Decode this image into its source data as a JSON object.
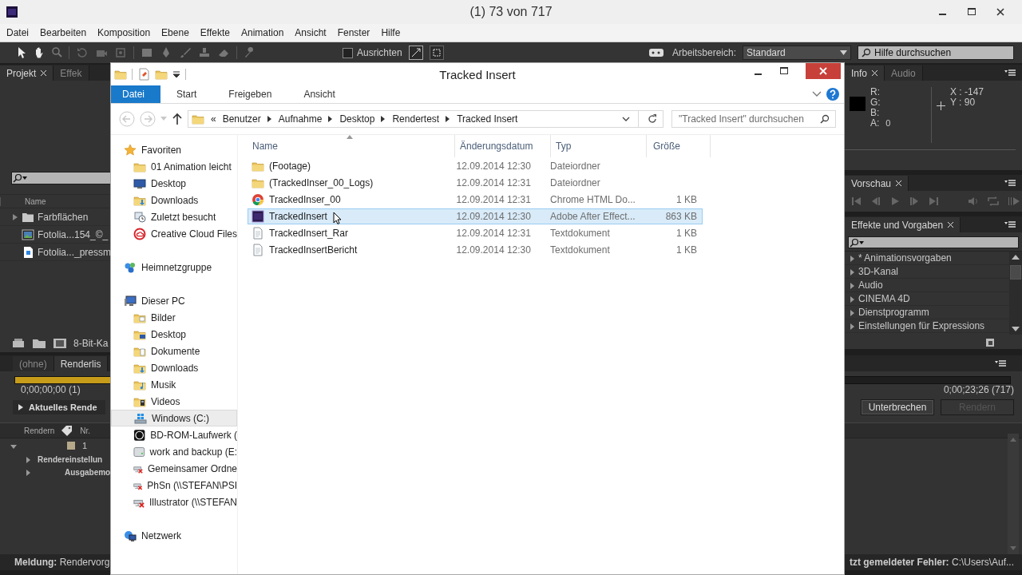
{
  "app_window": {
    "title": "(1) 73 von 717"
  },
  "menu": [
    "Datei",
    "Bearbeiten",
    "Komposition",
    "Ebene",
    "Effekte",
    "Animation",
    "Ansicht",
    "Fenster",
    "Hilfe"
  ],
  "toolbar": {
    "snap": {
      "label": "Ausrichten",
      "checked": false
    },
    "workspace_label": "Arbeitsbereich:",
    "workspace_value": "Standard",
    "help_search_placeholder": "Hilfe durchsuchen"
  },
  "project_panel": {
    "tabs": [
      {
        "label": "Projekt",
        "selected": true
      },
      {
        "label": "Effek",
        "selected": false
      }
    ],
    "column": "Name",
    "items": [
      {
        "name": "Farbflächen",
        "kind": "folder"
      },
      {
        "name": "Fotolia...154_©_",
        "kind": "footage"
      },
      {
        "name": "Fotolia..._pressm",
        "kind": "image"
      }
    ],
    "footer_label": "8-Bit-Ka"
  },
  "info_panel": {
    "tabs": [
      {
        "label": "Info",
        "selected": true
      },
      {
        "label": "Audio",
        "selected": false
      }
    ],
    "channels": [
      {
        "label": "R:"
      },
      {
        "label": "G:"
      },
      {
        "label": "B:"
      },
      {
        "label": "A:",
        "value": "0"
      }
    ],
    "coords": [
      "X : -147",
      "Y : 90"
    ]
  },
  "preview_panel": {
    "tabs": [
      {
        "label": "Vorschau",
        "selected": true
      }
    ]
  },
  "effects_panel": {
    "tabs": [
      {
        "label": "Effekte und Vorgaben",
        "selected": true
      }
    ],
    "items": [
      {
        "label": "* Animationsvorgaben",
        "expanded": false
      },
      {
        "label": "3D-Kanal",
        "expanded": false
      },
      {
        "label": "Audio",
        "expanded": false
      },
      {
        "label": "CINEMA 4D",
        "expanded": false
      },
      {
        "label": "Dienstprogramm",
        "expanded": false
      },
      {
        "label": "Einstellungen für Expressions",
        "expanded": false
      }
    ]
  },
  "render_panel": {
    "tabs": [
      {
        "label": "(ohne)",
        "selected": false
      },
      {
        "label": "Renderlis",
        "selected": true
      }
    ],
    "level": 0.11,
    "elapsed": "0;00;00;00 (1)",
    "total": "0;00;23;26 (717)",
    "current_label": "Aktuelles Rende",
    "buttons": [
      {
        "label": "Unterbrechen",
        "disabled": false
      },
      {
        "label": "Rendern",
        "disabled": true
      }
    ],
    "columns": [
      "Rendern",
      "Nr."
    ],
    "items": [
      {
        "number": "1",
        "color": "#b5a98a",
        "expanded": true,
        "children": [
          {
            "label": "Rendereinstellun",
            "expanded": false
          },
          {
            "label": "Ausgabemo",
            "expanded": false
          }
        ]
      }
    ],
    "status_left_label": "Meldung:",
    "status_left_value": "Rendervorg",
    "status_right_label": "tzt gemeldeter Fehler:",
    "status_right_value": "C:\\Users\\Auf..."
  },
  "explorer": {
    "title": "Tracked Insert",
    "ribbon_tabs": [
      {
        "label": "Datei",
        "selected": true
      },
      {
        "label": "Start",
        "selected": false
      },
      {
        "label": "Freigeben",
        "selected": false
      },
      {
        "label": "Ansicht",
        "selected": false
      }
    ],
    "overflow_marker": "«",
    "path": [
      "Benutzer",
      "Aufnahme",
      "Desktop",
      "Rendertest",
      "Tracked Insert"
    ],
    "search_placeholder": "\"Tracked Insert\" durchsuchen",
    "nav": [
      {
        "label": "Favoriten",
        "kind": "star",
        "selected": false,
        "children": [
          {
            "label": "01 Animation leicht",
            "kind": "folder",
            "selected": false
          },
          {
            "label": "Desktop",
            "kind": "desktop",
            "selected": false
          },
          {
            "label": "Downloads",
            "kind": "download",
            "selected": false
          },
          {
            "label": "Zuletzt besucht",
            "kind": "recent",
            "selected": false
          },
          {
            "label": "Creative Cloud Files",
            "kind": "cloud",
            "selected": false
          }
        ]
      },
      {
        "label": "Heimnetzgruppe",
        "kind": "homegroup",
        "selected": false
      },
      {
        "label": "Dieser PC",
        "kind": "computer",
        "selected": false,
        "children": [
          {
            "label": "Bilder",
            "kind": "pictures",
            "selected": false
          },
          {
            "label": "Desktop",
            "kind": "desktop-folder",
            "selected": false
          },
          {
            "label": "Dokumente",
            "kind": "documents",
            "selected": false
          },
          {
            "label": "Downloads",
            "kind": "download",
            "selected": false
          },
          {
            "label": "Musik",
            "kind": "music",
            "selected": false
          },
          {
            "label": "Videos",
            "kind": "videos",
            "selected": false
          },
          {
            "label": "Windows (C:)",
            "kind": "windows-drive",
            "selected": true
          },
          {
            "label": "BD-ROM-Laufwerk (",
            "kind": "optical-drive",
            "selected": false
          },
          {
            "label": "work and backup (E:",
            "kind": "drive",
            "selected": false
          },
          {
            "label": "Gemeinsamer Ordne",
            "kind": "offline-drive",
            "selected": false
          },
          {
            "label": "PhSn (\\\\STEFAN\\PSI",
            "kind": "offline-drive",
            "selected": false
          },
          {
            "label": "Illustrator (\\\\STEFAN",
            "kind": "offline-drive",
            "selected": false
          }
        ]
      },
      {
        "label": "Netzwerk",
        "kind": "network",
        "selected": false
      }
    ],
    "columns": [
      "Name",
      "Änderungsdatum",
      "Typ",
      "Größe"
    ],
    "files": [
      {
        "name": "(Footage)",
        "date": "12.09.2014 12:30",
        "type": "Dateiordner",
        "kind": "folder",
        "selected": false
      },
      {
        "name": "(TrackedInser_00_Logs)",
        "date": "12.09.2014 12:31",
        "type": "Dateiordner",
        "kind": "folder",
        "selected": false
      },
      {
        "name": "TrackedInser_00",
        "date": "12.09.2014 12:31",
        "type": "Chrome HTML Do...",
        "size": "1 KB",
        "kind": "chrome",
        "selected": false
      },
      {
        "name": "TrackedInsert",
        "date": "12.09.2014 12:30",
        "type": "Adobe After Effect...",
        "size": "863 KB",
        "kind": "ae",
        "selected": true
      },
      {
        "name": "TrackedInsert_Rar",
        "date": "12.09.2014 12:31",
        "type": "Textdokument",
        "size": "1 KB",
        "kind": "text",
        "selected": false
      },
      {
        "name": "TrackedInsertBericht",
        "date": "12.09.2014 12:30",
        "type": "Textdokument",
        "size": "1 KB",
        "kind": "text",
        "selected": false
      }
    ]
  }
}
